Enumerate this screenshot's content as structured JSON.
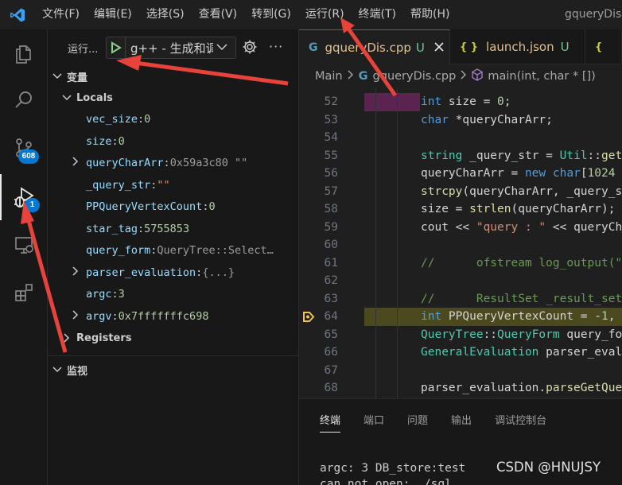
{
  "menu": {
    "items": [
      "文件(F)",
      "编辑(E)",
      "选择(S)",
      "查看(V)",
      "转到(G)",
      "运行(R)",
      "终端(T)",
      "帮助(H)"
    ],
    "window_title": "gqueryDis"
  },
  "activity_bar": {
    "source_control_badge": "608",
    "run_debug_badge": "1"
  },
  "debug_toolbar": {
    "run_label": "运行...",
    "config_label": "g++ - 生成和调试活动文件"
  },
  "variables": {
    "title": "变量",
    "locals_label": "Locals",
    "items": [
      {
        "name": "vec_size",
        "value": "0",
        "kind": "num",
        "expandable": false
      },
      {
        "name": "size",
        "value": "0",
        "kind": "num",
        "expandable": false
      },
      {
        "name": "queryCharArr",
        "value": "0x59a3c80 \"\"",
        "kind": "dim",
        "expandable": true
      },
      {
        "name": "_query_str",
        "value": "\"\"",
        "kind": "str",
        "expandable": false
      },
      {
        "name": "PPQueryVertexCount",
        "value": "0",
        "kind": "num",
        "expandable": false
      },
      {
        "name": "star_tag",
        "value": "5755853",
        "kind": "num",
        "expandable": false
      },
      {
        "name": "query_form",
        "value": "QueryTree::Select…",
        "kind": "dim",
        "expandable": false
      },
      {
        "name": "parser_evaluation",
        "value": "{...}",
        "kind": "dim",
        "expandable": true
      },
      {
        "name": "argc",
        "value": "3",
        "kind": "num",
        "expandable": false
      },
      {
        "name": "argv",
        "value": "0x7fffffffc698",
        "kind": "num",
        "expandable": true
      }
    ],
    "registers_label": "Registers"
  },
  "watch": {
    "title": "监视"
  },
  "tabs": [
    {
      "label": "gqueryDis.cpp",
      "suffix": "U",
      "icon": "G",
      "active": true
    },
    {
      "label": "launch.json",
      "suffix": "U",
      "icon": "{}",
      "active": false
    }
  ],
  "breadcrumb": {
    "root": "Main",
    "file": "gqueryDis.cpp",
    "symbol": "main(int, char * [])"
  },
  "code": {
    "breakpoint_line": 64,
    "lines": [
      {
        "n": "52",
        "tokens": [
          [
            "kw",
            "int"
          ],
          [
            "op",
            " size = "
          ],
          [
            "nu",
            "0"
          ],
          [
            "op",
            ";"
          ]
        ]
      },
      {
        "n": "53",
        "tokens": [
          [
            "kw",
            "char"
          ],
          [
            "op",
            " *queryCharArr;"
          ]
        ]
      },
      {
        "n": "54",
        "tokens": []
      },
      {
        "n": "55",
        "tokens": [
          [
            "ty",
            "string"
          ],
          [
            "op",
            " _query_str = "
          ],
          [
            "ty",
            "Util"
          ],
          [
            "op",
            "::"
          ],
          [
            "fn",
            "getQueryFromFile"
          ]
        ]
      },
      {
        "n": "56",
        "tokens": [
          [
            "op",
            "queryCharArr = "
          ],
          [
            "kw",
            "new"
          ],
          [
            "op",
            " "
          ],
          [
            "kw",
            "char"
          ],
          [
            "op",
            "["
          ],
          [
            "nu",
            "1024"
          ]
        ]
      },
      {
        "n": "57",
        "tokens": [
          [
            "fn",
            "strcpy"
          ],
          [
            "op",
            "(queryCharArr, _query_str"
          ]
        ]
      },
      {
        "n": "58",
        "tokens": [
          [
            "op",
            "size = "
          ],
          [
            "fn",
            "strlen"
          ],
          [
            "op",
            "(queryCharArr);"
          ]
        ]
      },
      {
        "n": "59",
        "tokens": [
          [
            "op",
            "cout << "
          ],
          [
            "st",
            "\"query : \""
          ],
          [
            "op",
            " << queryCharArr"
          ]
        ]
      },
      {
        "n": "60",
        "tokens": []
      },
      {
        "n": "61",
        "tokens": [
          [
            "cm",
            "//      ofstream log_output(\"log_all"
          ]
        ]
      },
      {
        "n": "62",
        "tokens": []
      },
      {
        "n": "63",
        "tokens": [
          [
            "cm",
            "//      ResultSet _result_set;"
          ]
        ]
      },
      {
        "n": "64",
        "tokens": [
          [
            "kw",
            "int"
          ],
          [
            "op",
            " PPQueryVertexCount = -"
          ],
          [
            "nu",
            "1"
          ],
          [
            "op",
            ","
          ]
        ]
      },
      {
        "n": "65",
        "tokens": [
          [
            "ty",
            "QueryTree"
          ],
          [
            "op",
            "::"
          ],
          [
            "ty",
            "QueryForm"
          ],
          [
            "op",
            " query_form"
          ]
        ]
      },
      {
        "n": "66",
        "tokens": [
          [
            "ty",
            "GeneralEvaluation"
          ],
          [
            "op",
            " parser_evaluation"
          ]
        ]
      },
      {
        "n": "67",
        "tokens": []
      },
      {
        "n": "68",
        "tokens": [
          [
            "op",
            "parser_evaluation."
          ],
          [
            "fn",
            "parseGetQuery"
          ]
        ]
      }
    ]
  },
  "panel": {
    "tabs": [
      "终端",
      "端口",
      "问题",
      "输出",
      "调试控制台"
    ],
    "terminal_lines": [
      "argc: 3 DB_store:test",
      "can not open: ./sql"
    ],
    "watermark": "CSDN @HNUJSY"
  },
  "colors": {
    "accent": "#0078d4",
    "play": "#89d185",
    "arrow": "#e8433a",
    "breakpoint": "#f6c343"
  }
}
